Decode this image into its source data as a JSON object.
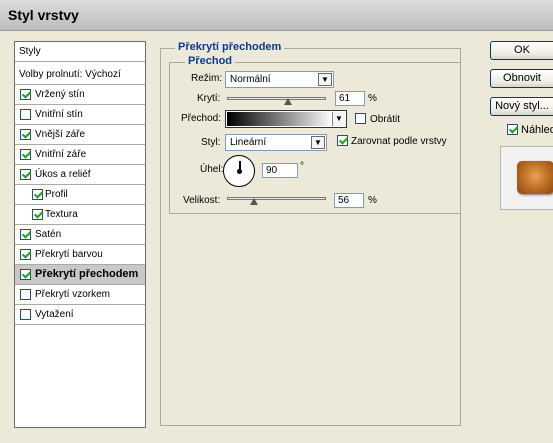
{
  "window": {
    "title": "Styl vrstvy"
  },
  "left_panel": {
    "header": "Styly",
    "blend_options": "Volby prolnutí: Výchozí",
    "items": [
      {
        "label": "Vržený stín",
        "checked": true
      },
      {
        "label": "Vnitřní stín",
        "checked": false
      },
      {
        "label": "Vnější záře",
        "checked": true
      },
      {
        "label": "Vnitřní záře",
        "checked": true
      },
      {
        "label": "Úkos a reliéf",
        "checked": true
      },
      {
        "label": "Profil",
        "checked": true,
        "indent": true
      },
      {
        "label": "Textura",
        "checked": true,
        "indent": true
      },
      {
        "label": "Satén",
        "checked": true
      },
      {
        "label": "Překrytí barvou",
        "checked": true
      },
      {
        "label": "Překrytí přechodem",
        "checked": true,
        "selected": true
      },
      {
        "label": "Překrytí vzorkem",
        "checked": false
      },
      {
        "label": "Vytažení",
        "checked": false
      }
    ]
  },
  "main": {
    "section_title": "Překrytí přechodem",
    "subsection_title": "Přechod",
    "mode_label": "Režim:",
    "mode_value": "Normální",
    "opacity_label": "Krytí:",
    "opacity_value": "61",
    "opacity_unit": "%",
    "gradient_label": "Přechod:",
    "reverse_label": "Obrátit",
    "reverse_checked": false,
    "style_label": "Styl:",
    "style_value": "Lineární",
    "align_label": "Zarovnat podle vrstvy",
    "align_checked": true,
    "angle_label": "Úhel:",
    "angle_value": "90",
    "angle_unit": "°",
    "scale_label": "Velikost:",
    "scale_value": "56",
    "scale_unit": "%"
  },
  "buttons": {
    "ok": "OK",
    "reset": "Obnovit",
    "new_style": "Nový styl...",
    "preview_label": "Náhled",
    "preview_checked": true
  },
  "colors": {
    "legend": "#0b3a8e",
    "preview_swatch": "#c57a2e",
    "checkmark": "#21a121"
  }
}
